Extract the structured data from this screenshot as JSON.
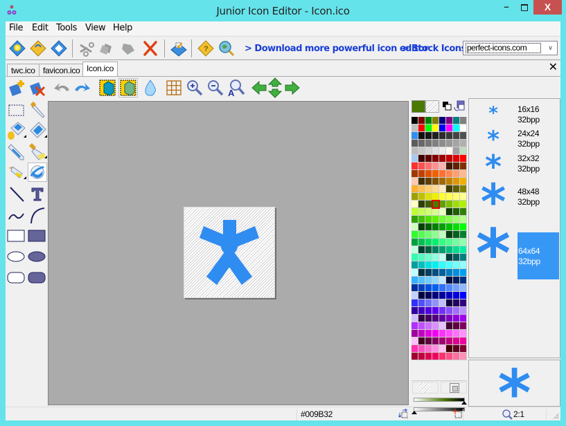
{
  "window": {
    "title": "Junior Icon Editor - Icon.ico",
    "minimize_label": "–",
    "close_label": "X"
  },
  "menu": [
    "File",
    "Edit",
    "Tools",
    "View",
    "Help"
  ],
  "toolbar": {
    "icons": [
      "new-icon",
      "open-icon",
      "save-icon",
      "cut-icon",
      "copy-icon",
      "paste-icon",
      "delete-icon",
      "import-icon",
      "help-icon",
      "search-web-icon"
    ],
    "link_download": "> Download more powerful icon editor",
    "link_stock": "> Stock Icons",
    "site_combo_value": "perfect-icons.com"
  },
  "tabs": [
    {
      "label": "twc.ico",
      "active": false
    },
    {
      "label": "favicon.ico",
      "active": false
    },
    {
      "label": "Icon.ico",
      "active": true
    }
  ],
  "tab_close_label": "✕",
  "edit_toolbar": [
    "new-image-icon",
    "delete-image-icon",
    "undo-icon",
    "redo-icon",
    "apply-effect-icon",
    "transparent-3d-icon",
    "drop-icon",
    "grid-icon",
    "zoom-in-icon",
    "zoom-out-icon",
    "zoom-actual-icon",
    "move-left-icon",
    "move-up-down-icon",
    "move-right-icon"
  ],
  "tools": [
    "select-rect-tool",
    "eyedropper-tool",
    "fill-tool",
    "eraser-tool",
    "pencil-tool",
    "brush-tool",
    "airbrush-tool",
    "color-replace-tool",
    "line-tool",
    "text-tool",
    "curve-tool",
    "arc-tool",
    "rect-outline-tool",
    "rect-filled-tool",
    "ellipse-outline-tool",
    "ellipse-filled-tool",
    "roundrect-outline-tool",
    "roundrect-filled-tool"
  ],
  "active_tool": "color-replace-tool",
  "canvas": {
    "glyph": "*",
    "glyph_color": "#2f8cf0"
  },
  "colors": {
    "primary": "#4a7a00",
    "secondary": "transparent",
    "selected_swatch_index": 91
  },
  "palette": [
    "#000000",
    "#800000",
    "#008000",
    "#808000",
    "#000080",
    "#800080",
    "#008080",
    "#808080",
    "#c0c0c0",
    "#ff0000",
    "#00ff00",
    "#ffff00",
    "#0000ff",
    "#ff00ff",
    "#00ffff",
    "#ffffff",
    "#3090f0",
    "#101010",
    "#181818",
    "#202020",
    "#2c2c2c",
    "#383838",
    "#444444",
    "#505050",
    "#5c5c5c",
    "#686868",
    "#747474",
    "#808080",
    "#8c8c8c",
    "#989898",
    "#a4a4a4",
    "#b0b0b0",
    "#bcbcbc",
    "#c8c8c8",
    "#d4d4d4",
    "#e0e0e0",
    "#ececec",
    "#fff8ee",
    "#a0a0a4",
    "#c0dcc0",
    "#a6caf0",
    "#400000",
    "#600000",
    "#800000",
    "#a00000",
    "#c00000",
    "#e00000",
    "#ff0000",
    "#ff3030",
    "#ff5050",
    "#ff7070",
    "#ff9090",
    "#ffb0b0",
    "#401800",
    "#602000",
    "#803000",
    "#a03800",
    "#c04000",
    "#e05000",
    "#f06000",
    "#ff7030",
    "#ff8850",
    "#ffa070",
    "#ffb890",
    "#ffc8b0",
    "#403000",
    "#604000",
    "#805000",
    "#a06800",
    "#c08000",
    "#e09800",
    "#f0b000",
    "#ffb030",
    "#ffc050",
    "#ffd070",
    "#ffd890",
    "#ffe8c0",
    "#404000",
    "#606000",
    "#808000",
    "#a0a000",
    "#c0c000",
    "#e0e000",
    "#f0f000",
    "#ffff30",
    "#ffff50",
    "#ffff70",
    "#ffff90",
    "#ffffc0",
    "#304000",
    "#406000",
    "#4a7a00",
    "#60a000",
    "#80c000",
    "#a0e000",
    "#b0f000",
    "#c0ff30",
    "#c8ff50",
    "#d0ff70",
    "#d8ff90",
    "#e8ffc0",
    "#104000",
    "#206000",
    "#308000",
    "#30a000",
    "#40c000",
    "#50e000",
    "#60f000",
    "#70ff30",
    "#88ff50",
    "#a0ff70",
    "#b8ff90",
    "#d0ffc0",
    "#004000",
    "#006000",
    "#008000",
    "#00a000",
    "#00c000",
    "#00e000",
    "#00ff00",
    "#30ff30",
    "#50ff50",
    "#70ff70",
    "#90ff90",
    "#c0ffc0",
    "#004010",
    "#006020",
    "#008030",
    "#00a040",
    "#00c050",
    "#00e060",
    "#00f070",
    "#30ff80",
    "#50ff90",
    "#70ffa0",
    "#90ffb0",
    "#c0ffe0",
    "#004030",
    "#006040",
    "#008060",
    "#00a070",
    "#00c080",
    "#00e090",
    "#00f0a0",
    "#30ffb0",
    "#50ffc0",
    "#70ffd0",
    "#90ffe0",
    "#c0fff0",
    "#004040",
    "#006060",
    "#008080",
    "#00a0a0",
    "#00c0c0",
    "#00e0e0",
    "#00f0f0",
    "#30ffff",
    "#50ffff",
    "#70ffff",
    "#90ffff",
    "#c0ffff",
    "#003040",
    "#004060",
    "#005080",
    "#0060a0",
    "#0080c0",
    "#0090e0",
    "#00a0f0",
    "#30b0ff",
    "#50c0ff",
    "#70ccff",
    "#90d8ff",
    "#c0e8ff",
    "#001040",
    "#002060",
    "#003080",
    "#0030a0",
    "#0040c0",
    "#0050e0",
    "#0060f0",
    "#3070ff",
    "#5088ff",
    "#70a0ff",
    "#90b8ff",
    "#c0d0ff",
    "#000040",
    "#000060",
    "#000080",
    "#0000a0",
    "#0000c0",
    "#0000e0",
    "#0000ff",
    "#3030ff",
    "#5050ff",
    "#7070ff",
    "#9090ff",
    "#c0c0ff",
    "#100040",
    "#200060",
    "#300080",
    "#3000a0",
    "#4000c0",
    "#5000e0",
    "#6000f0",
    "#7030ff",
    "#8850ff",
    "#a070ff",
    "#b890ff",
    "#d0c0ff",
    "#300040",
    "#400060",
    "#500080",
    "#6000a0",
    "#8000c0",
    "#9000e0",
    "#a000f0",
    "#b030ff",
    "#c050ff",
    "#cc70ff",
    "#d890ff",
    "#e8c0ff",
    "#400030",
    "#600040",
    "#800060",
    "#a000a0",
    "#c000c0",
    "#e000e0",
    "#f000f0",
    "#ff30ff",
    "#ff50ff",
    "#ff70ff",
    "#ff90ff",
    "#ffc0ff",
    "#400020",
    "#600040",
    "#800060",
    "#a00070",
    "#c00080",
    "#e00090",
    "#f000a0",
    "#ff30b0",
    "#ff50c0",
    "#ff70d0",
    "#ff90e0",
    "#ffc0f0",
    "#400000",
    "#600020",
    "#800030",
    "#a00030",
    "#c00040",
    "#e00050",
    "#f00060",
    "#ff3070",
    "#ff5088",
    "#ff70a0",
    "#ff90b8"
  ],
  "formats": [
    {
      "size": "16x16",
      "depth": "32bpp",
      "selected": false
    },
    {
      "size": "24x24",
      "depth": "32bpp",
      "selected": false
    },
    {
      "size": "32x32",
      "depth": "32bpp",
      "selected": false
    },
    {
      "size": "48x48",
      "depth": "32bpp",
      "selected": false
    },
    {
      "size": "64x64",
      "depth": "32bpp",
      "selected": true
    }
  ],
  "preview": {
    "glyph": "*"
  },
  "statusbar": {
    "color_hex": "#009B32",
    "zoom": "2:1"
  }
}
